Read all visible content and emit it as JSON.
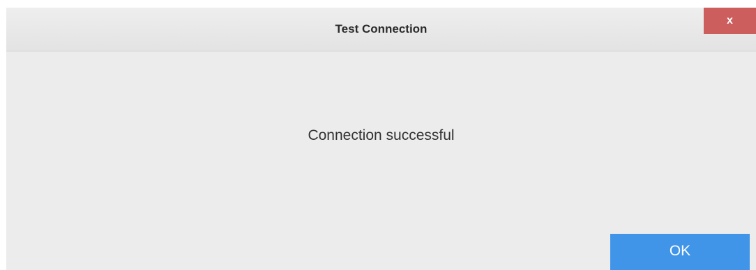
{
  "dialog": {
    "title": "Test Connection",
    "close_label": "x",
    "message": "Connection successful",
    "ok_label": "OK"
  },
  "colors": {
    "close_button": "#cd5e5e",
    "ok_button": "#4095e8",
    "dialog_background": "#ececec"
  }
}
